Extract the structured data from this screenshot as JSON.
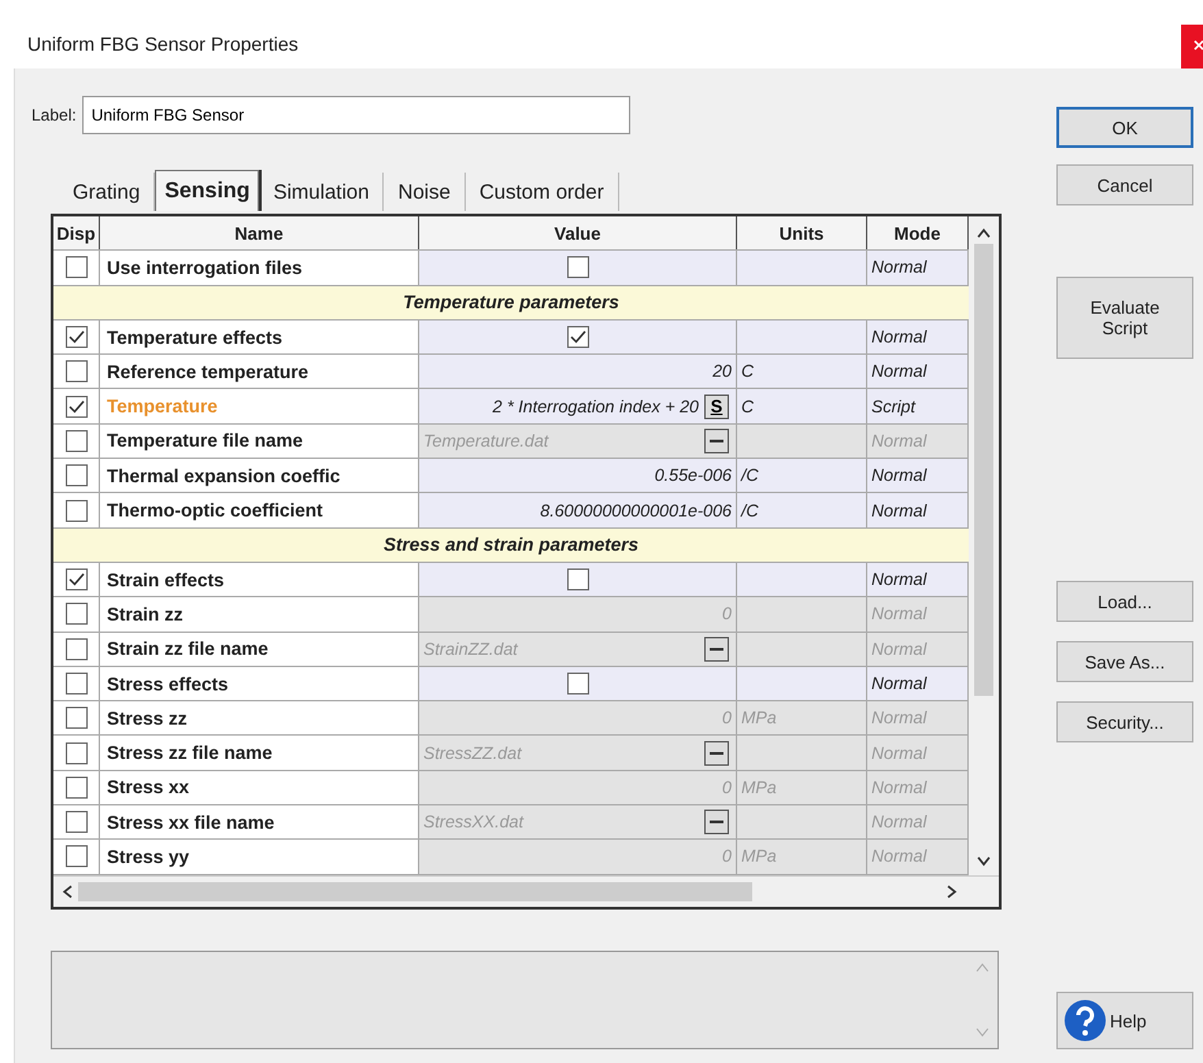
{
  "window": {
    "title": "Uniform FBG Sensor Properties"
  },
  "label_field": {
    "label": "Label:",
    "value": "Uniform FBG Sensor"
  },
  "tabs": [
    {
      "label": "Grating",
      "selected": false
    },
    {
      "label": "Sensing",
      "selected": true
    },
    {
      "label": "Simulation",
      "selected": false
    },
    {
      "label": "Noise",
      "selected": false
    },
    {
      "label": "Custom order",
      "selected": false
    }
  ],
  "table": {
    "columns": [
      "Disp",
      "Name",
      "Value",
      "Units",
      "Mode"
    ],
    "rows": [
      {
        "kind": "checkbox",
        "disp": false,
        "name": "Use interrogation files",
        "value_checked": false,
        "mode": "Normal",
        "enabled": true,
        "scripted": false
      },
      {
        "kind": "section",
        "name": "Temperature parameters"
      },
      {
        "kind": "checkbox",
        "disp": true,
        "name": "Temperature effects",
        "value_checked": true,
        "mode": "Normal",
        "enabled": true,
        "scripted": false
      },
      {
        "kind": "number",
        "disp": false,
        "name": "Reference temperature",
        "value": "20",
        "units": "C",
        "mode": "Normal",
        "enabled": true,
        "scripted": false
      },
      {
        "kind": "script",
        "disp": true,
        "name": "Temperature",
        "value": "2 * Interrogation index + 20",
        "button": "S",
        "units": "C",
        "mode": "Script",
        "enabled": true,
        "scripted": true
      },
      {
        "kind": "file",
        "disp": false,
        "name": "Temperature file name",
        "value": "Temperature.dat",
        "mode": "Normal",
        "enabled": false,
        "scripted": false
      },
      {
        "kind": "number",
        "disp": false,
        "name": "Thermal expansion coeffic",
        "value": "0.55e-006",
        "units": "/C",
        "mode": "Normal",
        "enabled": true,
        "scripted": false
      },
      {
        "kind": "number",
        "disp": false,
        "name": "Thermo-optic coefficient",
        "value": "8.60000000000001e-006",
        "units": "/C",
        "mode": "Normal",
        "enabled": true,
        "scripted": false
      },
      {
        "kind": "section",
        "name": "Stress and strain parameters"
      },
      {
        "kind": "checkbox",
        "disp": true,
        "name": "Strain effects",
        "value_checked": false,
        "mode": "Normal",
        "enabled": true,
        "scripted": false
      },
      {
        "kind": "number",
        "disp": false,
        "name": "Strain zz",
        "value": "0",
        "mode": "Normal",
        "enabled": false,
        "scripted": false
      },
      {
        "kind": "file",
        "disp": false,
        "name": "Strain zz file name",
        "value": "StrainZZ.dat",
        "mode": "Normal",
        "enabled": false,
        "scripted": false
      },
      {
        "kind": "checkbox",
        "disp": false,
        "name": "Stress effects",
        "value_checked": false,
        "mode": "Normal",
        "enabled": true,
        "scripted": false
      },
      {
        "kind": "number",
        "disp": false,
        "name": "Stress zz",
        "value": "0",
        "units": "MPa",
        "mode": "Normal",
        "enabled": false,
        "scripted": false
      },
      {
        "kind": "file",
        "disp": false,
        "name": "Stress zz file name",
        "value": "StressZZ.dat",
        "mode": "Normal",
        "enabled": false,
        "scripted": false
      },
      {
        "kind": "number",
        "disp": false,
        "name": "Stress xx",
        "value": "0",
        "units": "MPa",
        "mode": "Normal",
        "enabled": false,
        "scripted": false
      },
      {
        "kind": "file",
        "disp": false,
        "name": "Stress xx file name",
        "value": "StressXX.dat",
        "mode": "Normal",
        "enabled": false,
        "scripted": false
      },
      {
        "kind": "number",
        "disp": false,
        "name": "Stress yy",
        "value": "0",
        "units": "MPa",
        "mode": "Normal",
        "enabled": false,
        "scripted": false
      }
    ]
  },
  "buttons_top": [
    "OK",
    "Cancel"
  ],
  "evaluate_button": "Evaluate Script",
  "buttons_side": [
    "Load...",
    "Save As...",
    "Security..."
  ],
  "help_button": "Help"
}
